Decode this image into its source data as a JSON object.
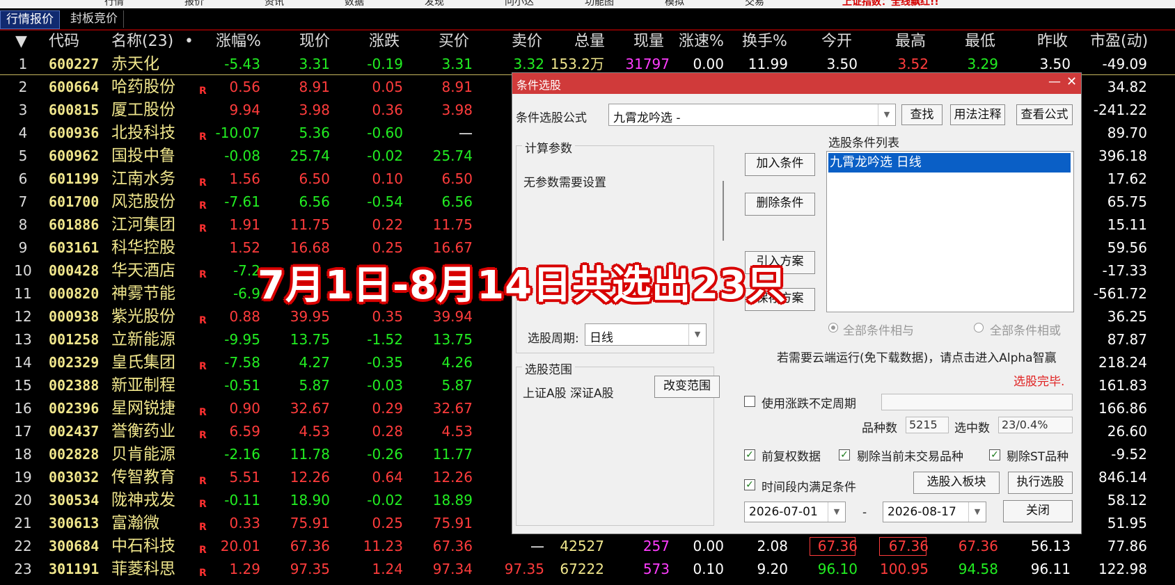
{
  "menubar": {
    "items": [
      "行情",
      "报价",
      "资讯",
      "数据",
      "发现",
      "问小达",
      "功能图",
      "模拟",
      "交易"
    ],
    "alert": "上证指数：全线飘红!!"
  },
  "tabs": [
    {
      "label": "行情报价",
      "active": true
    },
    {
      "label": "封板竞价",
      "active": false
    }
  ],
  "table": {
    "headers": [
      "▼",
      "代码",
      "名称(23)",
      "•",
      "涨幅%",
      "现价",
      "涨跌",
      "买价",
      "卖价",
      "总量",
      "现量",
      "涨速%",
      "换手%",
      "今开",
      "最高",
      "最低",
      "昨收",
      "市盈(动)"
    ],
    "rows": [
      {
        "idx": "1",
        "code": "600227",
        "name": "赤天化",
        "flag": "",
        "chg": "-5.43",
        "price": "3.31",
        "diff": "-0.19",
        "bid": "3.31",
        "ask": "3.32",
        "vol": "153.2万",
        "cur": "31797",
        "spd": "0.00",
        "turn": "11.99",
        "open": "3.50",
        "high": "3.52",
        "low": "3.29",
        "prev": "3.50",
        "pe": "-49.09"
      },
      {
        "idx": "2",
        "code": "600664",
        "name": "哈药股份",
        "flag": "R",
        "chg": "0.56",
        "price": "8.91",
        "diff": "0.05",
        "bid": "8.91",
        "pe": "34.82"
      },
      {
        "idx": "3",
        "code": "600815",
        "name": "厦工股份",
        "flag": "",
        "chg": "9.94",
        "price": "3.98",
        "diff": "0.36",
        "bid": "3.98",
        "pe": "-241.22"
      },
      {
        "idx": "4",
        "code": "600936",
        "name": "北投科技",
        "flag": "R",
        "chg": "-10.07",
        "price": "5.36",
        "diff": "-0.60",
        "bid": "—",
        "pe": "89.70"
      },
      {
        "idx": "5",
        "code": "600962",
        "name": "国投中鲁",
        "flag": "",
        "chg": "-0.08",
        "price": "25.74",
        "diff": "-0.02",
        "bid": "25.74",
        "pe": "396.18"
      },
      {
        "idx": "6",
        "code": "601199",
        "name": "江南水务",
        "flag": "R",
        "chg": "1.56",
        "price": "6.50",
        "diff": "0.10",
        "bid": "6.50",
        "pe": "17.62"
      },
      {
        "idx": "7",
        "code": "601700",
        "name": "风范股份",
        "flag": "R",
        "chg": "-7.61",
        "price": "6.56",
        "diff": "-0.54",
        "bid": "6.56",
        "pe": "65.75"
      },
      {
        "idx": "8",
        "code": "601886",
        "name": "江河集团",
        "flag": "R",
        "chg": "1.91",
        "price": "11.75",
        "diff": "0.22",
        "bid": "11.75",
        "pe": "15.11"
      },
      {
        "idx": "9",
        "code": "603161",
        "name": "科华控股",
        "flag": "",
        "chg": "1.52",
        "price": "16.68",
        "diff": "0.25",
        "bid": "16.67",
        "pe": "59.56"
      },
      {
        "idx": "10",
        "code": "000428",
        "name": "华天酒店",
        "flag": "R",
        "chg": "-7.2",
        "price": "",
        "diff": "",
        "bid": "",
        "pe": "-17.33"
      },
      {
        "idx": "11",
        "code": "000820",
        "name": "神雾节能",
        "flag": "",
        "chg": "-6.9",
        "price": "",
        "diff": "",
        "bid": "",
        "pe": "-561.72"
      },
      {
        "idx": "12",
        "code": "000938",
        "name": "紫光股份",
        "flag": "R",
        "chg": "0.88",
        "price": "39.95",
        "diff": "0.35",
        "bid": "39.94",
        "pe": "36.25"
      },
      {
        "idx": "13",
        "code": "001258",
        "name": "立新能源",
        "flag": "",
        "chg": "-9.95",
        "price": "13.75",
        "diff": "-1.52",
        "bid": "13.75",
        "pe": "87.87"
      },
      {
        "idx": "14",
        "code": "002329",
        "name": "皇氏集团",
        "flag": "R",
        "chg": "-7.58",
        "price": "4.27",
        "diff": "-0.35",
        "bid": "4.26",
        "pe": "218.24"
      },
      {
        "idx": "15",
        "code": "002388",
        "name": "新亚制程",
        "flag": "",
        "chg": "-0.51",
        "price": "5.87",
        "diff": "-0.03",
        "bid": "5.87",
        "pe": "161.83"
      },
      {
        "idx": "16",
        "code": "002396",
        "name": "星网锐捷",
        "flag": "R",
        "chg": "0.90",
        "price": "32.67",
        "diff": "0.29",
        "bid": "32.67",
        "pe": "166.86"
      },
      {
        "idx": "17",
        "code": "002437",
        "name": "誉衡药业",
        "flag": "R",
        "chg": "6.59",
        "price": "4.53",
        "diff": "0.28",
        "bid": "4.53",
        "pe": "26.60"
      },
      {
        "idx": "18",
        "code": "002828",
        "name": "贝肯能源",
        "flag": "",
        "chg": "-2.16",
        "price": "11.78",
        "diff": "-0.26",
        "bid": "11.77",
        "pe": "-9.52"
      },
      {
        "idx": "19",
        "code": "003032",
        "name": "传智教育",
        "flag": "R",
        "chg": "5.51",
        "price": "12.26",
        "diff": "0.64",
        "bid": "12.26",
        "pe": "846.14"
      },
      {
        "idx": "20",
        "code": "300534",
        "name": "陇神戎发",
        "flag": "R",
        "chg": "-0.11",
        "price": "18.90",
        "diff": "-0.02",
        "bid": "18.89",
        "pe": "58.12"
      },
      {
        "idx": "21",
        "code": "300613",
        "name": "富瀚微",
        "flag": "R",
        "chg": "0.33",
        "price": "75.91",
        "diff": "0.25",
        "bid": "75.91",
        "pe": "51.95"
      },
      {
        "idx": "22",
        "code": "300684",
        "name": "中石科技",
        "flag": "R",
        "chg": "20.01",
        "price": "67.36",
        "diff": "11.23",
        "bid": "67.36",
        "ask": "—",
        "vol": "42527",
        "cur": "257",
        "spd": "0.00",
        "turn": "2.08",
        "open": "67.36",
        "high": "67.36",
        "low": "67.36",
        "prev": "56.13",
        "pe": "77.86"
      },
      {
        "idx": "23",
        "code": "301191",
        "name": "菲菱科思",
        "flag": "R",
        "chg": "1.29",
        "price": "97.35",
        "diff": "1.24",
        "bid": "97.34",
        "ask": "97.35",
        "vol": "67222",
        "cur": "573",
        "spd": "0.10",
        "turn": "9.20",
        "open": "96.10",
        "high": "100.95",
        "low": "94.58",
        "prev": "96.11",
        "pe": "122.98"
      }
    ]
  },
  "overlay_text": "7月1日-8月14日共选出23只",
  "dialog": {
    "title": "条件选股",
    "formula_label": "条件选股公式",
    "formula_value": "九霄龙吟选  -",
    "find": "查找",
    "usage": "用法注释",
    "view": "查看公式",
    "calc_params": "计算参数",
    "no_params": "无参数需要设置",
    "add": "加入条件",
    "delete": "删除条件",
    "import": "引入方案",
    "save": "保存方案",
    "cond_list": "选股条件列表",
    "cond_item": "九霄龙吟选  日线",
    "period_label": "选股周期:",
    "period_value": "日线",
    "all_and": "全部条件相与",
    "all_or": "全部条件相或",
    "cloud_note": "若需要云端运行(免下载数据)，请点击进入Alpha智赢",
    "done": "选股完毕.",
    "scope_label": "选股范围",
    "scope_value": "上证A股 深证A股",
    "change_scope": "改变范围",
    "use_var_period": "使用涨跌不定周期",
    "count_label": "品种数",
    "count_value": "5215",
    "selected_label": "选中数",
    "selected_value": "23/0.4%",
    "fq": "前复权数据",
    "excl_notrade": "剔除当前未交易品种",
    "excl_st": "剔除ST品种",
    "time_range": "时间段内满足条件",
    "to_block": "选股入板块",
    "run": "执行选股",
    "date_from": "2026-07-01",
    "date_sep": "-",
    "date_to": "2026-08-17",
    "close": "关闭",
    "minimize": "—",
    "close_x": "✕"
  }
}
